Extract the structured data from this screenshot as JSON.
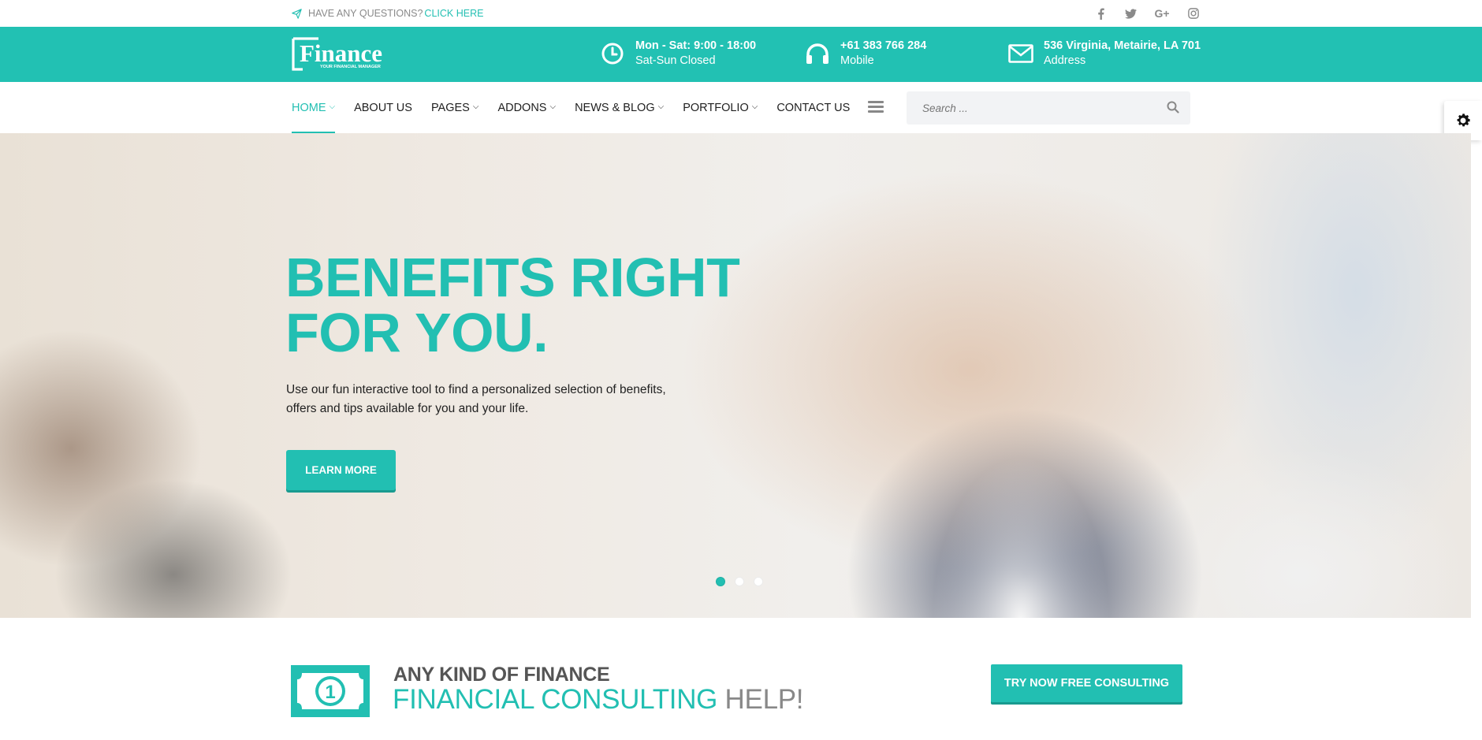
{
  "topbar": {
    "question": "HAVE ANY QUESTIONS?",
    "link": "CLICK HERE",
    "socials": [
      "facebook-icon",
      "twitter-icon",
      "google-plus-icon",
      "instagram-icon"
    ]
  },
  "brand": {
    "logo_text": "Finance",
    "logo_tagline": "YOUR FINANCIAL MANAGER"
  },
  "info": {
    "hours": {
      "title": "Mon - Sat: 9:00 - 18:00",
      "sub": "Sat-Sun Closed"
    },
    "phone": {
      "title": "+61 383 766 284",
      "sub": "Mobile"
    },
    "address": {
      "title": "536 Virginia, Metairie, LA 701",
      "sub": "Address"
    }
  },
  "nav": {
    "items": [
      {
        "label": "HOME",
        "dropdown": true,
        "active": true
      },
      {
        "label": "ABOUT US",
        "dropdown": false
      },
      {
        "label": "PAGES",
        "dropdown": true
      },
      {
        "label": "ADDONS",
        "dropdown": true
      },
      {
        "label": "NEWS & BLOG",
        "dropdown": true
      },
      {
        "label": "PORTFOLIO",
        "dropdown": true
      },
      {
        "label": "CONTACT US",
        "dropdown": false
      }
    ],
    "search_placeholder": "Search ..."
  },
  "hero": {
    "headline_1": "BENEFITS RIGHT",
    "headline_2": "FOR YOU.",
    "desc_1": "Use our fun interactive tool to find a personalized selection of benefits,",
    "desc_2": "offers and tips available for you and your life.",
    "cta": "LEARN MORE",
    "slides": 3,
    "active_slide": 1
  },
  "promo": {
    "line1": "ANY KIND OF FINANCE",
    "line2_accent": "FINANCIAL CONSULTING",
    "line2_rest": "HELP!",
    "bill_digit": "1",
    "button": "TRY NOW FREE CONSULTING"
  },
  "colors": {
    "accent": "#22c1b3",
    "text": "#1f1f1f"
  }
}
